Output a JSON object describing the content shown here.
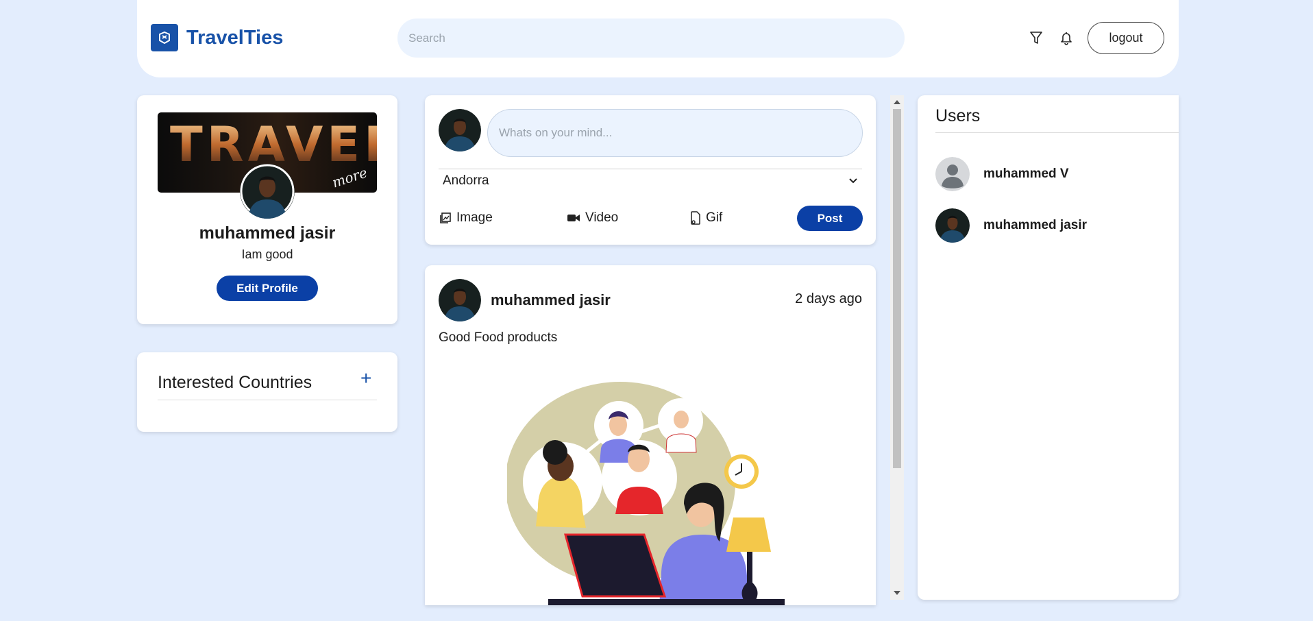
{
  "app": {
    "name": "TravelTies"
  },
  "header": {
    "search_placeholder": "Search",
    "filter_icon": "filter-icon",
    "bell_icon": "bell-icon",
    "logout_label": "logout"
  },
  "profile": {
    "banner_word": "TRAVEL",
    "banner_script": "more",
    "name": "muhammed jasir",
    "status": "Iam good",
    "edit_label": "Edit Profile"
  },
  "countries": {
    "title": "Interested Countries",
    "add_label": "+"
  },
  "composer": {
    "placeholder": "Whats on your mind...",
    "country": "Andorra",
    "actions": [
      {
        "label": "Image",
        "icon": "image-icon"
      },
      {
        "label": "Video",
        "icon": "video-icon"
      },
      {
        "label": "Gif",
        "icon": "gif-icon"
      }
    ],
    "post_label": "Post"
  },
  "post": {
    "author": "muhammed jasir",
    "time": "2 days ago",
    "text": "Good Food products"
  },
  "users": {
    "title": "Users",
    "list": [
      {
        "name": "muhammed V",
        "avatar": "default-avatar"
      },
      {
        "name": "muhammed jasir",
        "avatar": "photo-avatar"
      }
    ]
  },
  "colors": {
    "brand": "#1852a8",
    "button": "#0b40a6",
    "page_bg": "#e3edfd",
    "input_bg": "#ebf3fe"
  }
}
